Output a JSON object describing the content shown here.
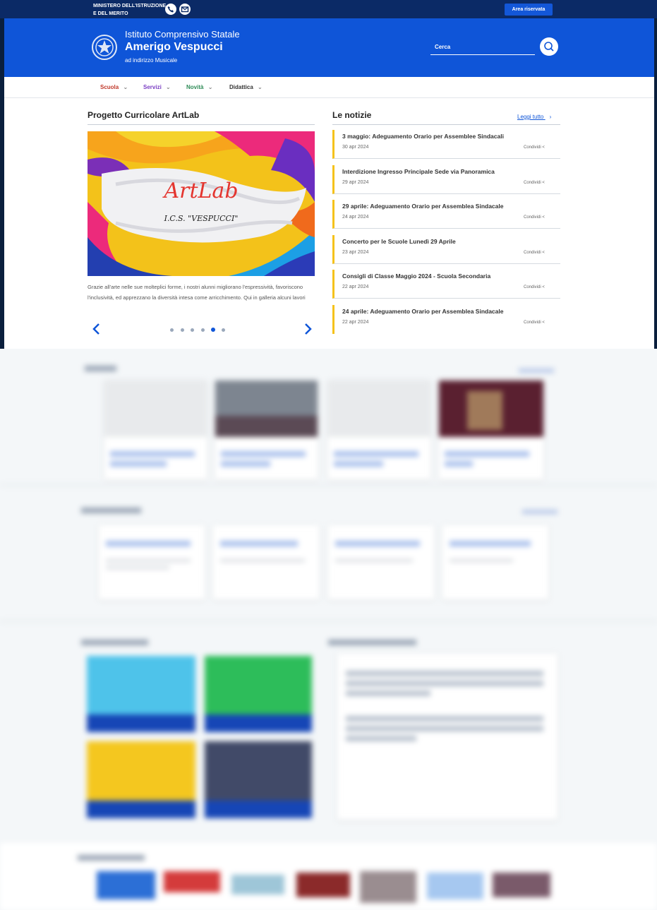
{
  "topbar": {
    "ministry_line1": "MINISTERO DELL'ISTRUZIONE",
    "ministry_line2": "E DEL MERITO",
    "area_button": "Area riservata"
  },
  "header": {
    "subtitle": "Istituto Comprensivo Statale",
    "name": "Amerigo Vespucci",
    "tagline": "ad indirizzo Musicale",
    "search_placeholder": "Cerca"
  },
  "nav": {
    "items": [
      {
        "label": "Scuola",
        "color": "#c0392b"
      },
      {
        "label": "Servizi",
        "color": "#7b3fc4"
      },
      {
        "label": "Novità",
        "color": "#2e8b57"
      },
      {
        "label": "Didattica",
        "color": "#333333"
      }
    ]
  },
  "project": {
    "title": "Progetto Curricolare ArtLab",
    "image_title": "ArtLab",
    "image_subtitle": "I.C.S. \"VESPUCCI\"",
    "caption": "Grazie all'arte nelle sue molteplici forme, i nostri alunni migliorano l'espressività, favoriscono l'inclusività, ed apprezzano la diversità intesa come arricchimento. Qui in galleria alcuni lavori",
    "slides_total": 6,
    "active_slide": 5
  },
  "news": {
    "title": "Le notizie",
    "read_all": "Leggi tutto",
    "share_label": "Condividi",
    "items": [
      {
        "title": "3 maggio: Adeguamento Orario per Assemblee Sindacali",
        "date": "30 apr 2024"
      },
      {
        "title": "Interdizione Ingresso Principale Sede via Panoramica",
        "date": "29 apr 2024"
      },
      {
        "title": "29 aprile: Adeguamento Orario per Assemblea Sindacale",
        "date": "24 apr 2024"
      },
      {
        "title": "Concerto per le Scuole Lunedì 29 Aprile",
        "date": "23 apr 2024"
      },
      {
        "title": "Consigli di Classe Maggio 2024 - Scuola Secondaria",
        "date": "22 apr 2024"
      },
      {
        "title": "24 aprile: Adeguamento Orario per Assemblea Sindacale",
        "date": "22 apr 2024"
      }
    ]
  },
  "colors": {
    "brand_blue": "#0f55d8",
    "dark_blue": "#0b2a66",
    "accent_yellow": "#f5c21b"
  }
}
